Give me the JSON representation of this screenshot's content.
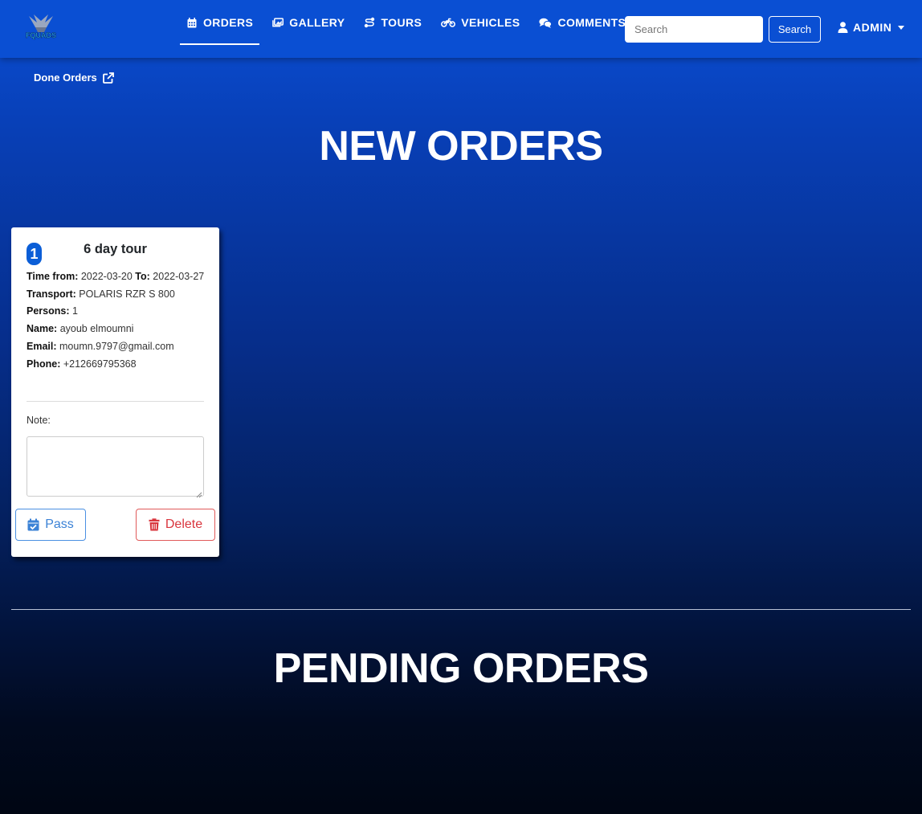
{
  "brand": {
    "logo_text": "FQUADS"
  },
  "nav": {
    "items": [
      {
        "label": "ORDERS",
        "icon": "calendar-icon",
        "active": true
      },
      {
        "label": "GALLERY",
        "icon": "images-icon",
        "active": false
      },
      {
        "label": "TOURS",
        "icon": "route-icon",
        "active": false
      },
      {
        "label": "VEHICLES",
        "icon": "motorcycle-icon",
        "active": false
      },
      {
        "label": "COMMENTS",
        "icon": "comments-icon",
        "active": false
      }
    ],
    "search_placeholder": "Search",
    "search_button": "Search",
    "user_label": "ADMIN"
  },
  "done_orders_link": "Done Orders",
  "sections": {
    "new_title": "NEW ORDERS",
    "pending_title": "PENDING ORDERS"
  },
  "order": {
    "number": "1",
    "title": "6 day tour",
    "time_from_label": "Time from:",
    "time_from": "2022-03-20",
    "to_label": "To:",
    "to": "2022-03-27",
    "transport_label": "Transport:",
    "transport": "POLARIS RZR S 800",
    "persons_label": "Persons:",
    "persons": "1",
    "name_label": "Name:",
    "name": "ayoub elmoumni",
    "email_label": "Email:",
    "email": "moumn.9797@gmail.com",
    "phone_label": "Phone:",
    "phone": "+212669795368",
    "note_label": "Note:",
    "note_value": "",
    "pass_button": "Pass",
    "delete_button": "Delete"
  },
  "colors": {
    "navbar": "#0a4fd3",
    "badge": "#0b5ed7",
    "pass": "#3b82d6",
    "delete": "#d9363e"
  }
}
